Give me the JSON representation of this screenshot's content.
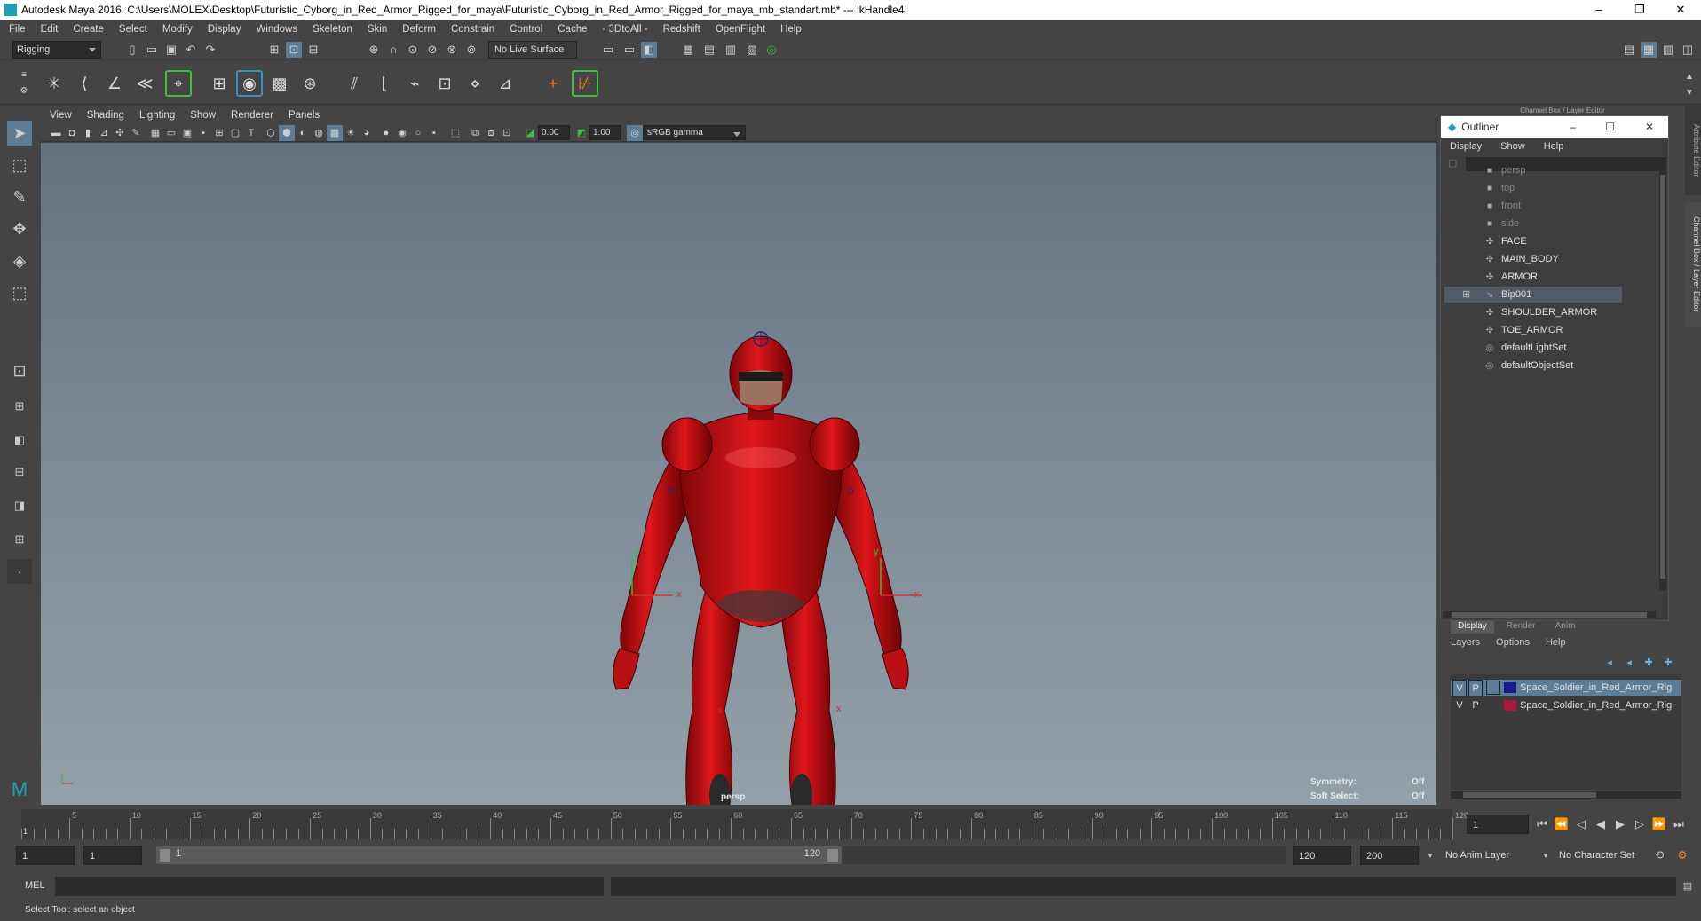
{
  "window": {
    "title": "Autodesk Maya 2016: C:\\Users\\MOLEX\\Desktop\\Futuristic_Cyborg_in_Red_Armor_Rigged_for_maya\\Futuristic_Cyborg_in_Red_Armor_Rigged_for_maya_mb_standart.mb*   ---   ikHandle4",
    "minimize": "–",
    "restore": "❐",
    "close": "✕"
  },
  "menubar": [
    "File",
    "Edit",
    "Create",
    "Select",
    "Modify",
    "Display",
    "Windows",
    "Skeleton",
    "Skin",
    "Deform",
    "Constrain",
    "Control",
    "Cache",
    "- 3DtoAll -",
    "Redshift",
    "OpenFlight",
    "Help"
  ],
  "statusline": {
    "mode": "Rigging",
    "live_surface": "No Live Surface"
  },
  "viewport": {
    "menu": [
      "View",
      "Shading",
      "Lighting",
      "Show",
      "Renderer",
      "Panels"
    ],
    "exposure": "0.00",
    "gamma": "1.00",
    "colorspace": "sRGB gamma",
    "camera_label": "persp",
    "symmetry_label": "Symmetry:",
    "symmetry_value": "Off",
    "soft_select_label": "Soft Select:",
    "soft_select_value": "Off",
    "axis_x": "x",
    "axis_y": "y"
  },
  "outliner": {
    "title": "Outliner",
    "menu": [
      "Display",
      "Show",
      "Help"
    ],
    "panel_title": "Channel Box / Layer Editor",
    "items": [
      {
        "label": "persp",
        "icon": "camera-icon",
        "dim": true
      },
      {
        "label": "top",
        "icon": "camera-icon",
        "dim": true
      },
      {
        "label": "front",
        "icon": "camera-icon",
        "dim": true
      },
      {
        "label": "side",
        "icon": "camera-icon",
        "dim": true
      },
      {
        "label": "FACE",
        "icon": "mesh-icon",
        "dim": false
      },
      {
        "label": "MAIN_BODY",
        "icon": "mesh-icon",
        "dim": false
      },
      {
        "label": "ARMOR",
        "icon": "mesh-icon",
        "dim": false
      },
      {
        "label": "Bip001",
        "icon": "joint-icon",
        "dim": false
      },
      {
        "label": "SHOULDER_ARMOR",
        "icon": "mesh-icon",
        "dim": false
      },
      {
        "label": "TOE_ARMOR",
        "icon": "mesh-icon",
        "dim": false
      },
      {
        "label": "defaultLightSet",
        "icon": "set-icon",
        "dim": false
      },
      {
        "label": "defaultObjectSet",
        "icon": "set-icon",
        "dim": false
      }
    ]
  },
  "layers": {
    "tabs": [
      "Display",
      "Render",
      "Anim"
    ],
    "menu": [
      "Layers",
      "Options",
      "Help"
    ],
    "rows": [
      {
        "v": "V",
        "p": "P",
        "name": "Space_Soldier_in_Red_Armor_Rig",
        "color": "#1a1a8c"
      },
      {
        "v": "V",
        "p": "P",
        "name": "Space_Soldier_in_Red_Armor_Rig",
        "color": "#b0163a"
      }
    ]
  },
  "side_tabs": {
    "attribute_editor": "Attribute Editor",
    "channel_box": "Channel Box / Layer Editor"
  },
  "timeline": {
    "ticks": [
      "5",
      "10",
      "15",
      "20",
      "25",
      "30",
      "35",
      "40",
      "45",
      "50",
      "55",
      "60",
      "65",
      "70",
      "75",
      "80",
      "85",
      "90",
      "95",
      "100",
      "105",
      "110",
      "115",
      "120"
    ],
    "start_tick": "1",
    "current_frame": "1"
  },
  "range": {
    "start": "1",
    "playback_start": "1",
    "slider_start": "1",
    "slider_end": "120",
    "playback_end": "120",
    "end": "200",
    "anim_layer": "No Anim Layer",
    "character_set": "No Character Set"
  },
  "cmdline": {
    "label": "MEL"
  },
  "helpline": "Select Tool: select an object"
}
